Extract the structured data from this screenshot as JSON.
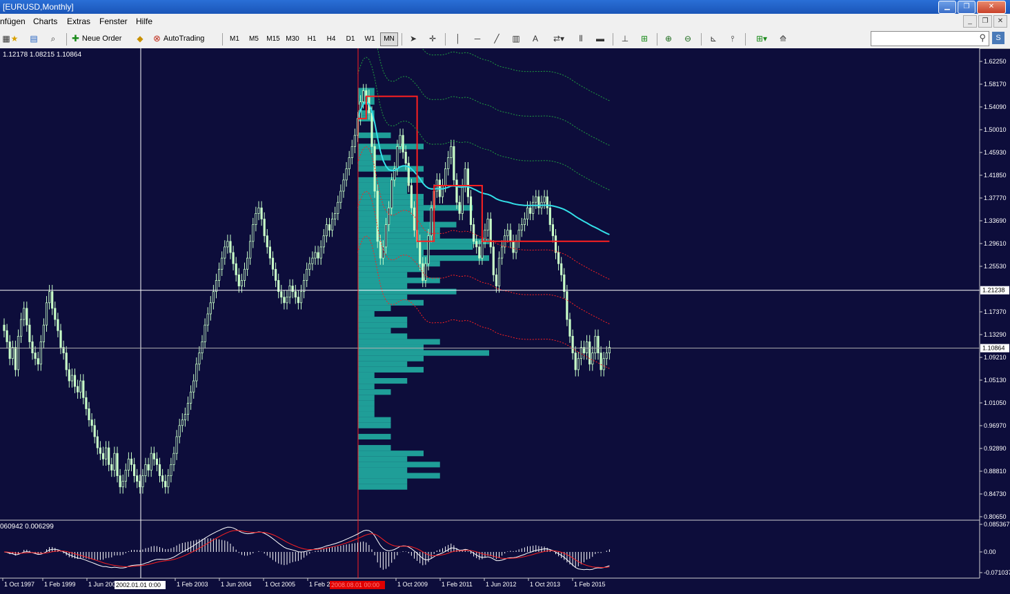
{
  "window": {
    "title": "[EURUSD,Monthly]"
  },
  "menu": {
    "items": [
      "nfügen",
      "Charts",
      "Extras",
      "Fenster",
      "Hilfe"
    ]
  },
  "toolbar": {
    "new_order": "Neue Order",
    "autotrading": "AutoTrading",
    "timeframes": [
      "M1",
      "M5",
      "M15",
      "M30",
      "H1",
      "H4",
      "D1",
      "W1",
      "MN"
    ],
    "active_timeframe": "MN",
    "search_placeholder": ""
  },
  "chart": {
    "symbol": "EURUSD",
    "period": "Monthly",
    "ohlc_text": "1.12178 1.08215 1.10864",
    "current_price": "1.10864",
    "crosshair_price": "1.21238",
    "crosshair_time": "2002.01.01 0:00",
    "selected_time": "2008.08.01 00:00",
    "price_axis": [
      "1.62250",
      "1.58170",
      "1.54090",
      "1.50010",
      "1.45930",
      "1.41850",
      "1.37770",
      "1.33690",
      "1.29610",
      "1.25530",
      "1.17370",
      "1.13290",
      "1.09210",
      "1.05130",
      "1.01050",
      "0.96970",
      "0.92890",
      "0.88810",
      "0.84730",
      "0.80650"
    ],
    "time_axis": [
      "1 Oct 1997",
      "1 Feb 1999",
      "1 Jun 200",
      "1 Feb 2003",
      "1 Jun 2004",
      "1 Oct 2005",
      "1 Feb 2",
      "1 Oct 2009",
      "1 Feb 2011",
      "1 Jun 2012",
      "1 Oct 2013",
      "1 Feb 2015"
    ],
    "indicator_text": "060942 0.006299",
    "indicator_axis": [
      "0.085367",
      "0.00",
      "-0.071037"
    ],
    "colors": {
      "background": "#0d0d3b",
      "bull": "#c8ffc8",
      "bear": "#c8ffc8",
      "profile": "#1f9e98",
      "vwap": "#33e0e8",
      "poc": "#ff2020",
      "bands_upper": "#1f9e40",
      "bands_lower": "#ff2020"
    },
    "series": {
      "closes": [
        1.14,
        1.12,
        1.09,
        1.11,
        1.07,
        1.13,
        1.16,
        1.18,
        1.15,
        1.12,
        1.1,
        1.09,
        1.08,
        1.12,
        1.15,
        1.19,
        1.21,
        1.18,
        1.16,
        1.14,
        1.11,
        1.1,
        1.07,
        1.05,
        1.06,
        1.04,
        1.03,
        1.05,
        1.02,
        1.0,
        0.98,
        0.97,
        0.95,
        0.93,
        0.92,
        0.91,
        0.93,
        0.9,
        0.89,
        0.92,
        0.88,
        0.86,
        0.87,
        0.89,
        0.91,
        0.9,
        0.88,
        0.87,
        0.86,
        0.88,
        0.9,
        0.89,
        0.92,
        0.91,
        0.9,
        0.88,
        0.87,
        0.86,
        0.88,
        0.9,
        0.92,
        0.95,
        0.97,
        0.98,
        0.99,
        1.01,
        1.03,
        1.05,
        1.08,
        1.1,
        1.12,
        1.15,
        1.17,
        1.19,
        1.21,
        1.23,
        1.25,
        1.27,
        1.29,
        1.3,
        1.28,
        1.26,
        1.24,
        1.22,
        1.23,
        1.25,
        1.27,
        1.3,
        1.33,
        1.35,
        1.36,
        1.34,
        1.31,
        1.29,
        1.27,
        1.25,
        1.23,
        1.21,
        1.2,
        1.19,
        1.2,
        1.22,
        1.21,
        1.2,
        1.19,
        1.21,
        1.23,
        1.25,
        1.26,
        1.27,
        1.28,
        1.27,
        1.29,
        1.31,
        1.33,
        1.32,
        1.34,
        1.35,
        1.37,
        1.39,
        1.41,
        1.43,
        1.45,
        1.47,
        1.49,
        1.52,
        1.55,
        1.57,
        1.56,
        1.53,
        1.47,
        1.39,
        1.3,
        1.27,
        1.29,
        1.33,
        1.36,
        1.41,
        1.43,
        1.47,
        1.49,
        1.46,
        1.44,
        1.4,
        1.36,
        1.32,
        1.3,
        1.26,
        1.23,
        1.26,
        1.31,
        1.36,
        1.39,
        1.41,
        1.38,
        1.4,
        1.43,
        1.45,
        1.47,
        1.41,
        1.37,
        1.35,
        1.4,
        1.43,
        1.38,
        1.33,
        1.3,
        1.29,
        1.27,
        1.3,
        1.32,
        1.34,
        1.29,
        1.24,
        1.22,
        1.27,
        1.29,
        1.31,
        1.32,
        1.3,
        1.28,
        1.3,
        1.32,
        1.33,
        1.34,
        1.36,
        1.35,
        1.37,
        1.38,
        1.36,
        1.37,
        1.38,
        1.36,
        1.33,
        1.31,
        1.28,
        1.26,
        1.24,
        1.21,
        1.16,
        1.13,
        1.1,
        1.07,
        1.09,
        1.11,
        1.1,
        1.12,
        1.08,
        1.1,
        1.13,
        1.1,
        1.07,
        1.09,
        1.1,
        1.11
      ]
    }
  }
}
